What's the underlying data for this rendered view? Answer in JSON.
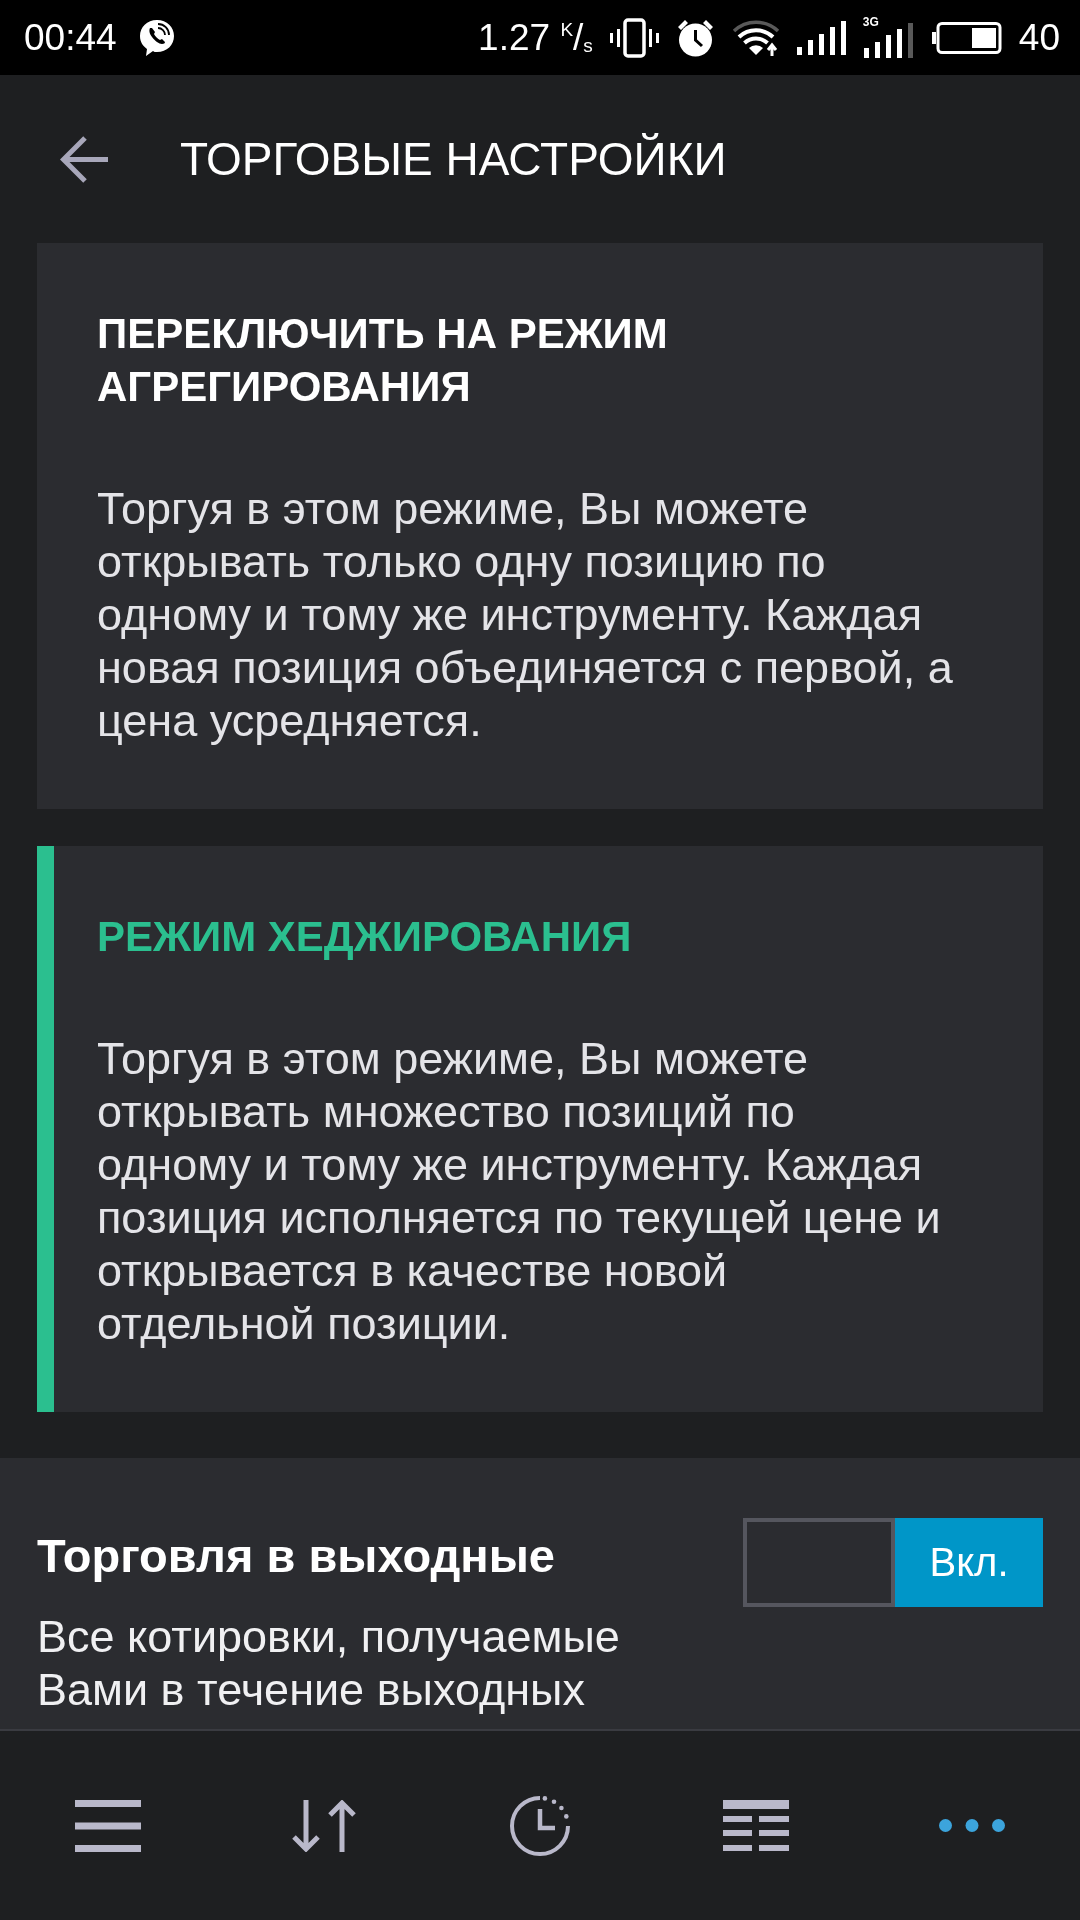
{
  "status_bar": {
    "time": "00:44",
    "speed": "1.27 $^{K}$/$_{s}$",
    "network_type": "3G",
    "battery": "40"
  },
  "header": {
    "title": "ТОРГОВЫЕ НАСТРОЙКИ"
  },
  "modes": [
    {
      "title": "ПЕРЕКЛЮЧИТЬ НА РЕЖИМ АГРЕГИРОВАНИЯ",
      "description": "Торгуя в этом режиме, Вы можете открывать только одну позицию по одному и тому же инструменту. Каждая новая позиция объединяется с первой, а цена усредняется.",
      "selected": false
    },
    {
      "title": "РЕЖИМ ХЕДЖИРОВАНИЯ",
      "description": "Торгуя в этом режиме, Вы можете открывать множество позиций по одному и тому же инструменту. Каждая позиция исполняется по текущей цене и открывается в качестве новой отдельной позиции.",
      "selected": true
    }
  ],
  "weekend": {
    "title": "Торговля в выходные",
    "description": "Все котировки, получаемые Вами в течение выходных",
    "toggle": {
      "label": "Вкл.",
      "on": true
    }
  },
  "bottom_nav": [
    {
      "selected": false
    },
    {
      "selected": false
    },
    {
      "selected": false
    },
    {
      "selected": false
    },
    {
      "selected": true
    }
  ]
}
